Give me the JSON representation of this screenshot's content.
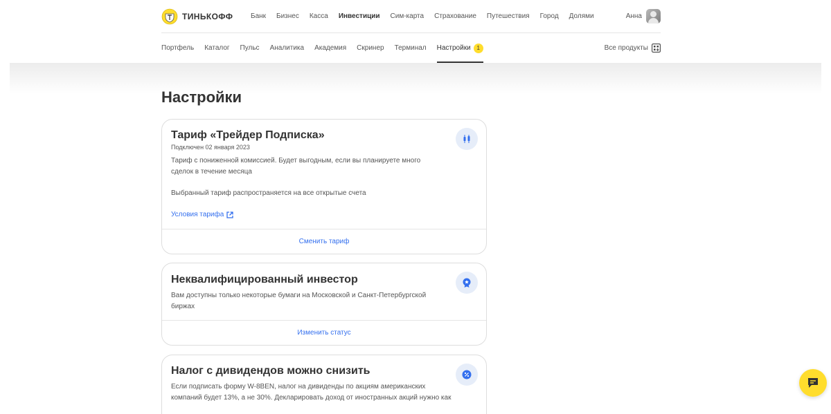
{
  "header": {
    "brand": "ТИНЬКОФФ",
    "nav": [
      {
        "label": "Банк"
      },
      {
        "label": "Бизнес"
      },
      {
        "label": "Касса"
      },
      {
        "label": "Инвестиции",
        "active": true
      },
      {
        "label": "Сим-карта"
      },
      {
        "label": "Страхование"
      },
      {
        "label": "Путешествия"
      },
      {
        "label": "Город"
      },
      {
        "label": "Долями"
      }
    ],
    "user_name": "Анна"
  },
  "subnav": {
    "items": [
      {
        "label": "Портфель"
      },
      {
        "label": "Каталог"
      },
      {
        "label": "Пульс"
      },
      {
        "label": "Аналитика"
      },
      {
        "label": "Академия"
      },
      {
        "label": "Скринер"
      },
      {
        "label": "Терминал"
      },
      {
        "label": "Настройки",
        "active": true,
        "badge": "1"
      }
    ],
    "all_products": "Все продукты"
  },
  "page": {
    "title": "Настройки"
  },
  "cards": {
    "tariff": {
      "title": "Тариф «Трейдер Подписка»",
      "connected": "Подключен 02 января 2023",
      "description": "Тариф с пониженной комиссией. Будет выгодным, если вы планируете много сделок в течение месяца",
      "note": "Выбранный тариф распространяется на все открытые счета",
      "link": "Условия тарифа",
      "action": "Сменить тариф",
      "icon": "candles-icon"
    },
    "investor": {
      "title": "Неквалифицированный инвестор",
      "description": "Вам доступны только некоторые бумаги на Московской и Санкт-Петербургской биржах",
      "action": "Изменить статус",
      "icon": "badge-icon"
    },
    "tax": {
      "title": "Налог с дивидендов можно снизить",
      "description": "Если подписать форму W-8BEN, налог на дивиденды по акциям американских компаний будет 13%, а не 30%. Декларировать доход от иностранных акций нужно как",
      "icon": "percent-icon"
    }
  },
  "colors": {
    "accent": "#336fee",
    "brand_yellow": "#ffdd2d",
    "icon_bg": "#e6edf9"
  }
}
